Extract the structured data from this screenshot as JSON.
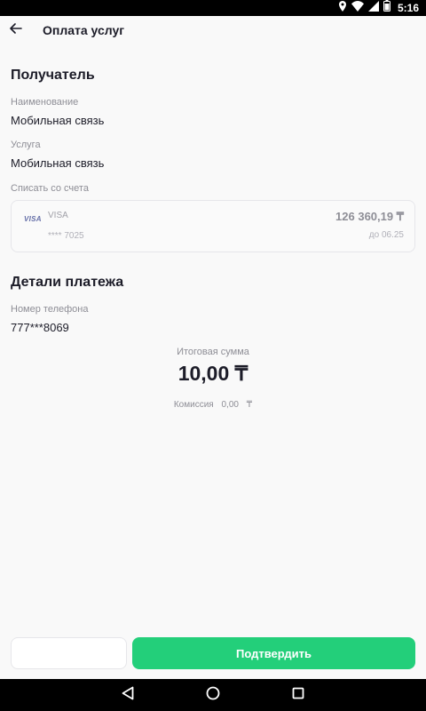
{
  "status_bar": {
    "time": "5:16"
  },
  "header": {
    "title": "Оплата услуг"
  },
  "recipient": {
    "section_title": "Получатель",
    "name_label": "Наименование",
    "name_value": "Мобильная связь",
    "service_label": "Услуга",
    "service_value": "Мобильная связь",
    "debit_label": "Списать со счета"
  },
  "account_card": {
    "logo_text": "VISA",
    "brand": "VISA",
    "number": "**** 7025",
    "balance": "126 360,19 ₸",
    "expiry": "до 06.25"
  },
  "payment_details": {
    "section_title": "Детали платежа",
    "phone_label": "Номер телефона",
    "phone_value": "777***8069"
  },
  "summary": {
    "total_label": "Итоговая сумма",
    "total_amount": "10,00 ₸",
    "commission_label": "Комиссия",
    "commission_value": "0,00",
    "commission_currency": "₸"
  },
  "actions": {
    "secondary_label": "",
    "confirm_label": "Подтвердить"
  },
  "colors": {
    "primary_green": "#23cf7a",
    "text_dark": "#1c1c28",
    "text_muted": "#8e8e96",
    "background": "#f9f9f9"
  }
}
